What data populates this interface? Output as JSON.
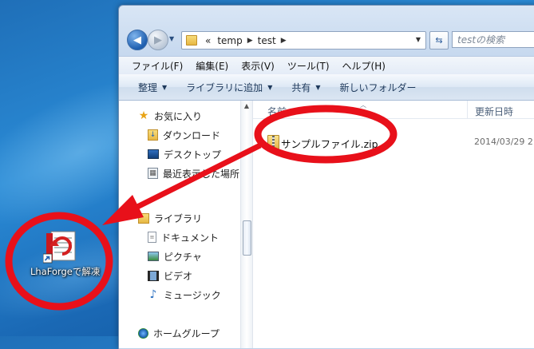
{
  "window": {
    "nav": {
      "back_icon": "back-arrow-icon",
      "forward_icon": "forward-arrow-icon"
    },
    "address": {
      "overflow": "«",
      "crumbs": [
        "temp",
        "test"
      ]
    },
    "search_placeholder": "testの検索",
    "menu": [
      "ファイル(F)",
      "編集(E)",
      "表示(V)",
      "ツール(T)",
      "ヘルプ(H)"
    ],
    "toolbar": {
      "organize": "整理",
      "add_to_library": "ライブラリに追加",
      "share": "共有",
      "new_folder": "新しいフォルダー"
    },
    "navpane": {
      "favorites": "お気に入り",
      "downloads": "ダウンロード",
      "desktop": "デスクトップ",
      "recent": "最近表示した場所",
      "libraries": "ライブラリ",
      "documents": "ドキュメント",
      "pictures": "ピクチャ",
      "videos": "ビデオ",
      "music": "ミュージック",
      "homegroup": "ホームグループ"
    },
    "columns": {
      "name": "名前",
      "date": "更新日時"
    },
    "files": [
      {
        "name": "サンプルファイル.zip",
        "date": "2014/03/29 2"
      }
    ]
  },
  "desktop": {
    "icon_label": "LhaForgeで解凍"
  },
  "colors": {
    "annotation": "#e8101a",
    "wallpaper": "#1f6fb8"
  }
}
